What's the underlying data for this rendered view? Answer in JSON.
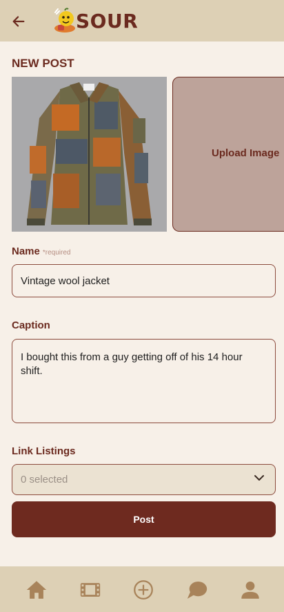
{
  "header": {
    "brand": "SOUR"
  },
  "page": {
    "title": "NEW POST"
  },
  "images": {
    "upload_label": "Upload Image"
  },
  "name_field": {
    "label": "Name",
    "required_note": "*required",
    "value": "Vintage wool jacket"
  },
  "caption_field": {
    "label": "Caption",
    "value": "I bought this from a guy getting off of his 14 hour shift."
  },
  "link_listings": {
    "label": "Link Listings",
    "selected_text": "0 selected"
  },
  "post_button": {
    "label": "Post"
  },
  "bottom_nav": {
    "items": [
      "home",
      "reels",
      "create",
      "messages",
      "profile"
    ]
  },
  "colors": {
    "accent": "#6e2a1f",
    "header_bg": "#ddd0b5",
    "page_bg": "#f7f0e8",
    "upload_tile": "#bda39a"
  }
}
